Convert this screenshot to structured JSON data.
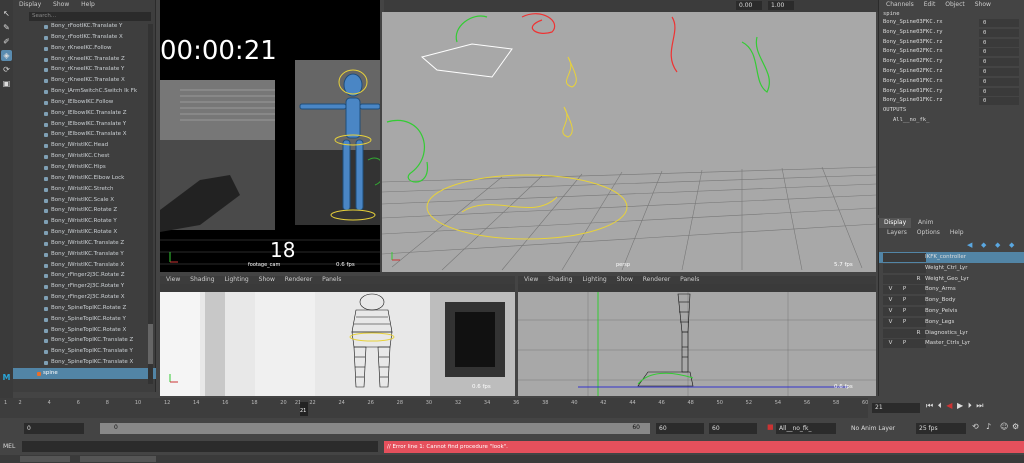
{
  "outliner": {
    "menu": [
      "Display",
      "Show",
      "Help"
    ],
    "search_placeholder": "Search...",
    "items": [
      "Bony_rFootIKC.Translate Y",
      "Bony_rFootIKC.Translate X",
      "Bony_rKneeIKC.Follow",
      "Bony_rKneeIKC.Translate Z",
      "Bony_rKneeIKC.Translate Y",
      "Bony_rKneeIKC.Translate X",
      "Bony_lArmSwitchC.Switch Ik Fk",
      "Bony_lElbowIKC.Follow",
      "Bony_lElbowIKC.Translate Z",
      "Bony_lElbowIKC.Translate Y",
      "Bony_lElbowIKC.Translate X",
      "Bony_lWristIKC.Head",
      "Bony_lWristIKC.Chest",
      "Bony_lWristIKC.Hips",
      "Bony_lWristIKC.Elbow Lock",
      "Bony_lWristIKC.Stretch",
      "Bony_lWristIKC.Scale X",
      "Bony_lWristIKC.Rotate Z",
      "Bony_lWristIKC.Rotate Y",
      "Bony_lWristIKC.Rotate X",
      "Bony_lWristIKC.Translate Z",
      "Bony_lWristIKC.Translate Y",
      "Bony_lWristIKC.Translate X",
      "Bony_rFinger2J3C.Rotate Z",
      "Bony_rFinger2J3C.Rotate Y",
      "Bony_rFinger2J3C.Rotate X",
      "Bony_SpineTopIKC.Rotate Z",
      "Bony_SpineTopIKC.Rotate Y",
      "Bony_SpineTopIKC.Rotate X",
      "Bony_SpineTopIKC.Translate Z",
      "Bony_SpineTopIKC.Translate Y",
      "Bony_SpineTopIKC.Translate X"
    ],
    "selected_item": "spine"
  },
  "top_bar": {
    "field_a": "0.00",
    "field_b": "1.00"
  },
  "camera_view": {
    "timecode": "00:00:21",
    "frame_number": "18",
    "camera_name": "footage_cam",
    "fps": "0.6 fps"
  },
  "persp_view": {
    "camera_name": "persp",
    "fps": "5.7 fps"
  },
  "viewport_menu": [
    "View",
    "Shading",
    "Lighting",
    "Show",
    "Renderer",
    "Panels"
  ],
  "bottom_left_view": {
    "fps": "0.6 fps"
  },
  "bottom_right_view": {
    "fps": "0.6 fps"
  },
  "channel_box": {
    "menu": [
      "Channels",
      "Edit",
      "Object",
      "Show"
    ],
    "node_name": "spine",
    "channels": [
      {
        "name": "Bony_Spine03FKC.rx",
        "value": "0"
      },
      {
        "name": "Bony_Spine03FKC.ry",
        "value": "0"
      },
      {
        "name": "Bony_Spine03FKC.rz",
        "value": "0"
      },
      {
        "name": "Bony_Spine02FKC.rx",
        "value": "0"
      },
      {
        "name": "Bony_Spine02FKC.ry",
        "value": "0"
      },
      {
        "name": "Bony_Spine02FKC.rz",
        "value": "0"
      },
      {
        "name": "Bony_Spine01FKC.rx",
        "value": "0"
      },
      {
        "name": "Bony_Spine01FKC.ry",
        "value": "0"
      },
      {
        "name": "Bony_Spine01FKC.rz",
        "value": "0"
      }
    ],
    "outputs_label": "OUTPUTS",
    "output_item": "All__no_fk_"
  },
  "layer_editor": {
    "tabs": [
      "Display",
      "Anim"
    ],
    "menu": [
      "Layers",
      "Options",
      "Help"
    ],
    "layers": [
      {
        "v": "",
        "p": "",
        "r": "",
        "name": "IKFK_controller",
        "selected": true
      },
      {
        "v": "",
        "p": "",
        "r": "",
        "name": "Weight_Ctrl_Lyr",
        "selected": false
      },
      {
        "v": "",
        "p": "",
        "r": "R",
        "name": "Weight_Geo_Lyr",
        "selected": false
      },
      {
        "v": "V",
        "p": "P",
        "r": "",
        "name": "Bony_Arms",
        "selected": false
      },
      {
        "v": "V",
        "p": "P",
        "r": "",
        "name": "Bony_Body",
        "selected": false
      },
      {
        "v": "V",
        "p": "P",
        "r": "",
        "name": "Bony_Pelvis",
        "selected": false
      },
      {
        "v": "V",
        "p": "P",
        "r": "",
        "name": "Bony_Legs",
        "selected": false
      },
      {
        "v": "",
        "p": "",
        "r": "R",
        "name": "Diagnostics_Lyr",
        "selected": false
      },
      {
        "v": "V",
        "p": "P",
        "r": "",
        "name": "Master_Ctrls_Lyr",
        "selected": false
      }
    ]
  },
  "time_slider": {
    "ticks": [
      "1",
      "2",
      "4",
      "6",
      "8",
      "10",
      "12",
      "14",
      "16",
      "18",
      "20",
      "21",
      "22",
      "24",
      "26",
      "28",
      "30",
      "32",
      "34",
      "36",
      "38",
      "40",
      "42",
      "44",
      "46",
      "48",
      "50",
      "52",
      "54",
      "56",
      "58",
      "60"
    ],
    "current_frame": "21",
    "current_frame_field": "21"
  },
  "range_slider": {
    "start": "0",
    "inner_start": "0",
    "inner_end": "60",
    "end": "60",
    "range_end": "60",
    "character_set": "All__no_fk_",
    "anim_layer": "No Anim Layer",
    "fps": "25 fps"
  },
  "command_line": {
    "label": "MEL",
    "error": "// Error line 1: Cannot find procedure \"look\"."
  },
  "colors": {
    "accent": "#5285a6",
    "error_bg": "#e5505c",
    "active_frame": "#cc3333"
  }
}
